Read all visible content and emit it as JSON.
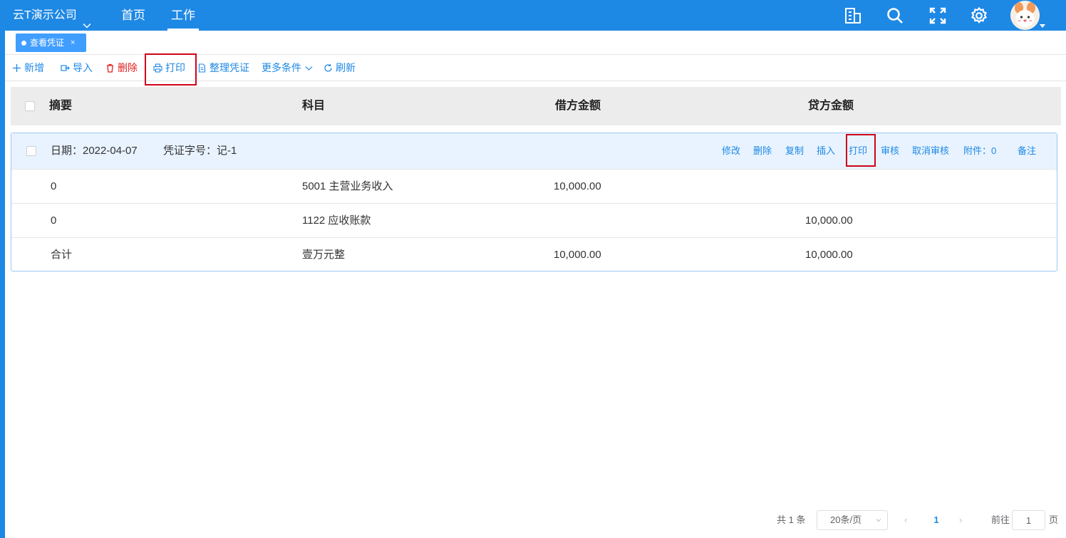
{
  "topbar": {
    "company": "云T演示公司",
    "nav": [
      "首页",
      "工作"
    ],
    "active_nav": "工作",
    "icons": [
      "building-icon",
      "search-icon",
      "fullscreen-icon",
      "settings-icon",
      "user-avatar"
    ]
  },
  "tabs": [
    {
      "label": "查看凭证",
      "close": "×"
    }
  ],
  "toolbar": {
    "add": "新增",
    "import": "导入",
    "delete": "删除",
    "print": "打印",
    "organize": "整理凭证",
    "more": "更多条件",
    "refresh": "刷新"
  },
  "table": {
    "headers": [
      "摘要",
      "科目",
      "借方金额",
      "贷方金额"
    ]
  },
  "voucher": {
    "date_label": "日期：2022-04-07",
    "number_label": "凭证字号：记-1",
    "actions": {
      "edit": "修改",
      "delete": "删除",
      "copy": "复制",
      "insert": "插入",
      "print": "打印",
      "audit": "审核",
      "cancel_audit": "取消审核",
      "attachments": "附件：0",
      "remark": "备注"
    },
    "rows": [
      {
        "summary": "0",
        "account": "5001 主营业务收入",
        "debit": "10,000.00",
        "credit": ""
      },
      {
        "summary": "0",
        "account": "1122 应收账款",
        "debit": "",
        "credit": "10,000.00"
      },
      {
        "summary": "合计",
        "account": "壹万元整",
        "debit": "10,000.00",
        "credit": "10,000.00"
      }
    ]
  },
  "pagination": {
    "total": "共 1 条",
    "page_size": "20条/页",
    "prev": "‹",
    "current": "1",
    "next": "›",
    "goto": "前往",
    "goto_value": "1",
    "page_suffix": "页"
  },
  "colors": {
    "primary": "#1e88e5",
    "tab": "#409eff",
    "danger": "#e02020",
    "highlight_box": "#d0021b"
  }
}
